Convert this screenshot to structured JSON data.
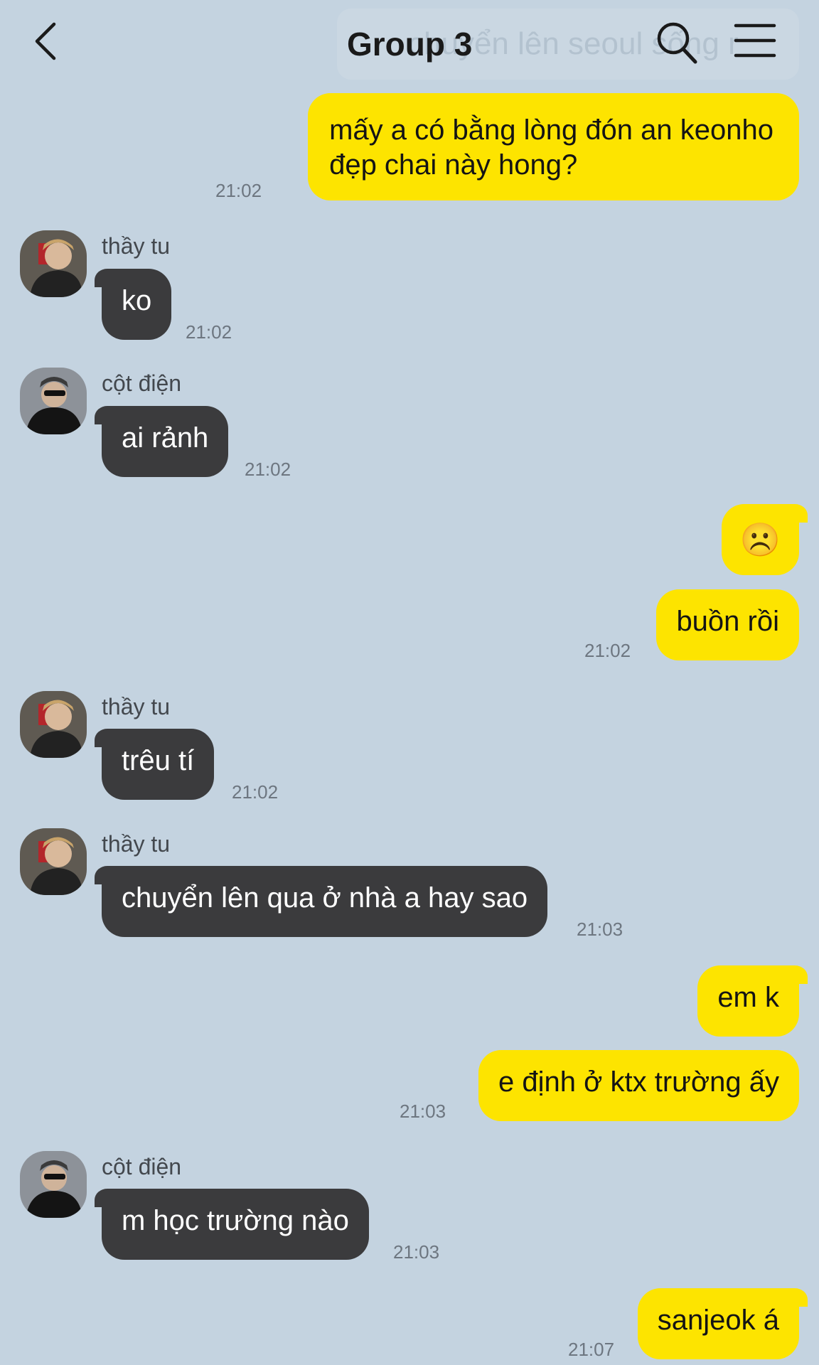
{
  "header": {
    "title": "Group 3",
    "search_hint": "chuyển lên seoul sống r",
    "back_icon": "chevron-left-icon",
    "search_icon": "search-icon",
    "menu_icon": "hamburger-menu-icon"
  },
  "colors": {
    "background": "#c4d3e0",
    "incoming_bubble": "#3b3b3d",
    "outgoing_bubble": "#fde400"
  },
  "messages": [
    {
      "from": "me",
      "text": "mấy a có bằng lòng đón an keonho",
      "text2": "đẹp chai này hong?",
      "time": "21:02"
    },
    {
      "from": "thầy tu",
      "text": "ko",
      "time": "21:02"
    },
    {
      "from": "cột điện",
      "text": "ai rảnh",
      "time": "21:02"
    },
    {
      "from": "me",
      "text": "☹️",
      "time": ""
    },
    {
      "from": "me",
      "text": "buồn rồi",
      "time": "21:02"
    },
    {
      "from": "thầy tu",
      "text": "trêu tí",
      "time": "21:02"
    },
    {
      "from": "thầy tu",
      "text": "chuyển lên qua ở nhà a hay sao",
      "time": "21:03"
    },
    {
      "from": "me",
      "text": "em k",
      "time": ""
    },
    {
      "from": "me",
      "text": "e định ở ktx trường ấy",
      "time": "21:03"
    },
    {
      "from": "cột điện",
      "text": "m học trường nào",
      "time": "21:03"
    },
    {
      "from": "me",
      "text": "sanjeok á",
      "time": "21:07"
    }
  ]
}
